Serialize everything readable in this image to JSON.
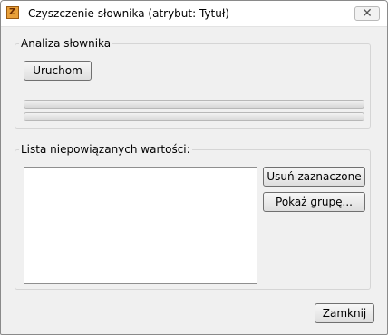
{
  "window": {
    "title": "Czyszczenie słownika (atrybut: Tytuł)",
    "close_glyph": "✕"
  },
  "analysis": {
    "legend": "Analiza słownika",
    "run_button": "Uruchom",
    "progress_1": 0,
    "progress_2": 0
  },
  "unlinked": {
    "legend": "Lista niepowiązanych wartości:",
    "items": [],
    "remove_selected_button": "Usuń zaznaczone",
    "show_group_button": "Pokaż grupę..."
  },
  "footer": {
    "close_button": "Zamknij"
  },
  "icons": {
    "app_icon": "dictionary-app-icon",
    "close_icon": "close-icon"
  }
}
